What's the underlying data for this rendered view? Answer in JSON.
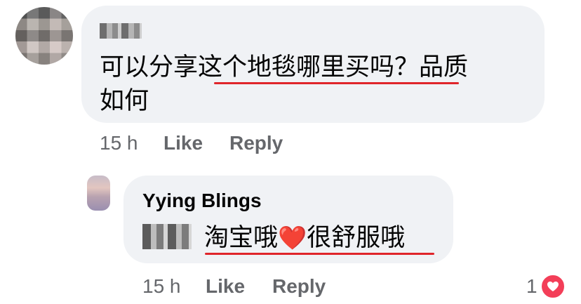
{
  "comment": {
    "text_line1": "可以分享这个地毯哪里买吗？品质",
    "text_line2": "如何",
    "time": "15 h",
    "like": "Like",
    "reply": "Reply"
  },
  "reply": {
    "author": "Yying Blings",
    "text_before_heart": "淘宝哦",
    "heart": "❤️",
    "text_after_heart": "很舒服哦",
    "time": "15 h",
    "like": "Like",
    "reply": "Reply",
    "reaction_count": "1",
    "reaction_icon": "heart-reaction-icon"
  },
  "colors": {
    "bubble_bg": "#f0f2f5",
    "meta_text": "#65676b",
    "underline": "#e0252a",
    "reaction": "#f33e58"
  }
}
